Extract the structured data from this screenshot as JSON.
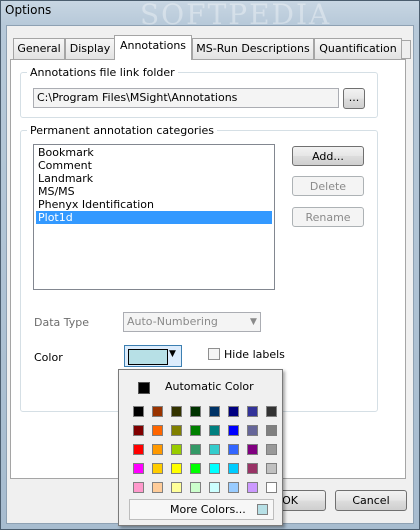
{
  "window": {
    "title": "Options"
  },
  "tabs": [
    {
      "label": "General"
    },
    {
      "label": "Display"
    },
    {
      "label": "Annotations"
    },
    {
      "label": "MS-Run Descriptions"
    },
    {
      "label": "Quantification"
    }
  ],
  "annotations": {
    "folder_group_label": "Annotations file link folder",
    "folder_path": "C:\\Program Files\\MSight\\Annotations",
    "browse_label": "...",
    "categories_group_label": "Permanent annotation categories",
    "categories": [
      "Bookmark",
      "Comment",
      "Landmark",
      "MS/MS",
      "Phenyx Identification",
      "Plot1d"
    ],
    "selected_category": "Plot1d",
    "add_label": "Add...",
    "delete_label": "Delete",
    "rename_label": "Rename",
    "data_type_label": "Data Type",
    "data_type_value": "Auto-Numbering",
    "color_label": "Color",
    "color_value": "#b7e0e6",
    "hide_labels_label": "Hide labels"
  },
  "color_popup": {
    "automatic_label": "Automatic Color",
    "more_colors_label": "More Colors...",
    "palette": [
      [
        "#000000",
        "#993300",
        "#333300",
        "#003300",
        "#003366",
        "#000080",
        "#333399",
        "#333333"
      ],
      [
        "#800000",
        "#ff6600",
        "#808000",
        "#008000",
        "#008080",
        "#0000ff",
        "#666699",
        "#808080"
      ],
      [
        "#ff0000",
        "#ff9900",
        "#99cc00",
        "#339966",
        "#33cccc",
        "#3366ff",
        "#800080",
        "#999999"
      ],
      [
        "#ff00ff",
        "#ffcc00",
        "#ffff00",
        "#00ff00",
        "#00ffff",
        "#00ccff",
        "#993366",
        "#c0c0c0"
      ],
      [
        "#ff99cc",
        "#ffcc99",
        "#ffff99",
        "#ccffcc",
        "#ccffff",
        "#99ccff",
        "#cc99ff",
        "#ffffff"
      ]
    ]
  },
  "footer": {
    "ok_label": "OK",
    "cancel_label": "Cancel"
  },
  "watermark": "SOFTPEDIA"
}
